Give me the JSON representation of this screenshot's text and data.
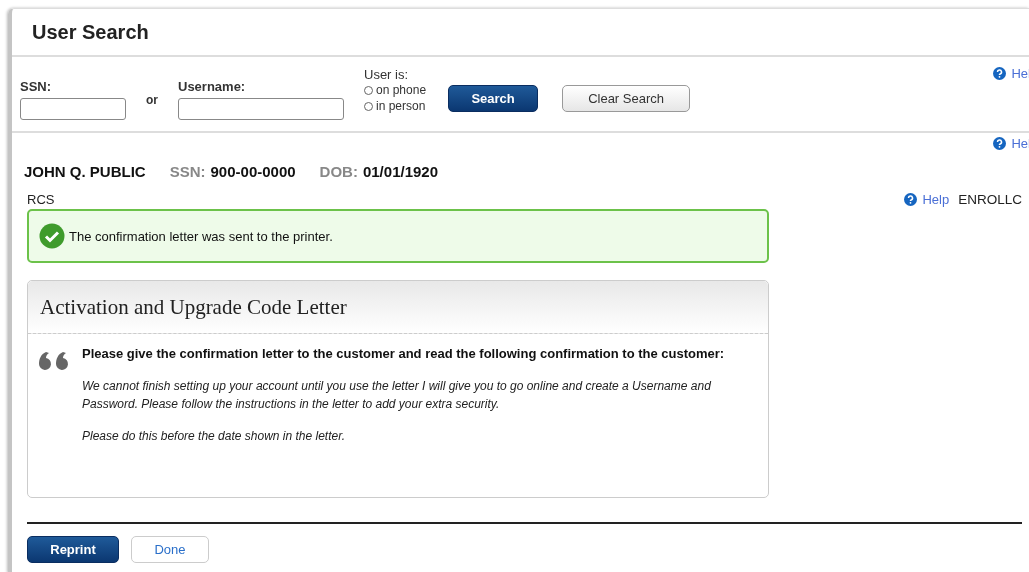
{
  "window": {
    "title": "User Search"
  },
  "search": {
    "ssn_label": "SSN:",
    "or_label": "or",
    "username_label": "Username:",
    "user_is_label": "User is:",
    "options": [
      {
        "label": "on phone",
        "selected": false
      },
      {
        "label": "in person",
        "selected": false
      }
    ],
    "buttons": [
      {
        "label": "Search",
        "kind": "primary"
      },
      {
        "label": "Clear Search",
        "kind": "secondary"
      }
    ],
    "help": "Hel"
  },
  "person": {
    "help": "Hel",
    "name": "JOHN Q. PUBLIC",
    "ssn_label": "SSN:",
    "ssn": "900-00-0000",
    "dob_label": "DOB:",
    "dob": "01/01/1920"
  },
  "section": {
    "label": "RCS",
    "help": "Help",
    "code": "ENROLLC"
  },
  "alert": {
    "message": "The confirmation letter was sent to the printer."
  },
  "card": {
    "title": "Activation and Upgrade Code Letter",
    "instruction": "Please give the confirmation letter to the customer and read the following confirmation to the customer:",
    "script": [
      "We cannot finish setting up your account until you use the letter I will give you to go online and create a Username and Password. Please follow the instructions in the letter to add your extra security.",
      "Please do this before the date shown in the letter."
    ]
  },
  "footer_buttons": [
    {
      "label": "Reprint",
      "kind": "primary"
    },
    {
      "label": "Done",
      "kind": "secondary"
    }
  ]
}
